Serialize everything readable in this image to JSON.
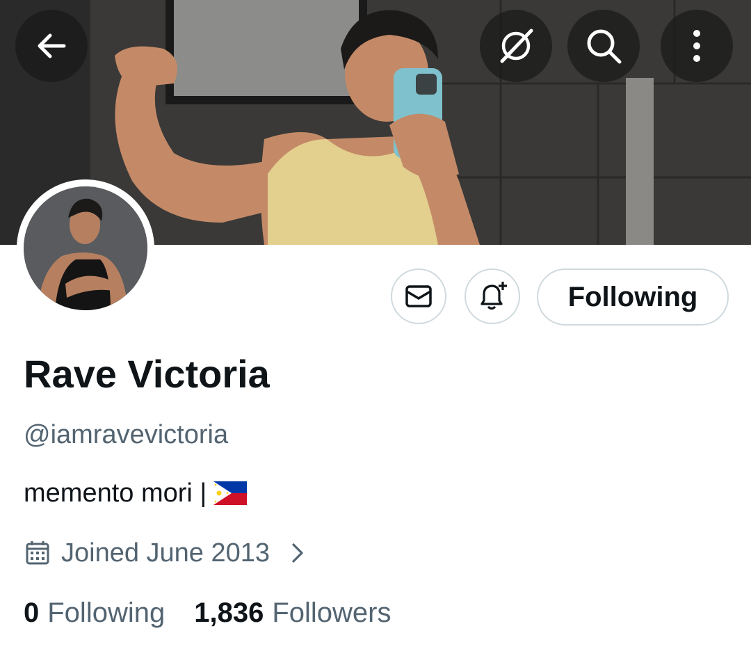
{
  "header": {
    "back_icon": "arrow-left-icon",
    "grok_icon": "grok-icon",
    "search_icon": "search-icon",
    "more_icon": "more-vertical-icon"
  },
  "actions": {
    "message_icon": "envelope-icon",
    "notify_icon": "bell-plus-icon",
    "follow_label": "Following"
  },
  "profile": {
    "name": "Rave Victoria",
    "handle": "@iamravevictoria",
    "bio": "memento mori |",
    "bio_flag": "philippines-flag",
    "joined": "Joined June 2013"
  },
  "stats": {
    "following_count": "0",
    "following_label": "Following",
    "followers_count": "1,836",
    "followers_label": "Followers"
  },
  "colors": {
    "text_primary": "#0f1419",
    "text_secondary": "#536471",
    "border": "#cfd9de"
  }
}
